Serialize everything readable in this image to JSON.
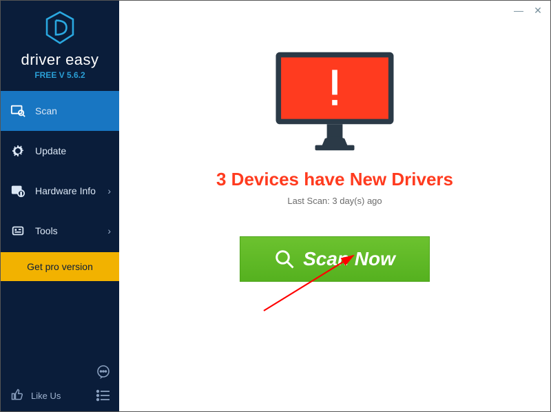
{
  "brand": {
    "name": "driver easy",
    "version": "FREE V 5.6.2"
  },
  "nav": {
    "scan": "Scan",
    "update": "Update",
    "hardware": "Hardware Info",
    "tools": "Tools"
  },
  "pro_button": "Get pro version",
  "like_us": "Like Us",
  "main": {
    "headline": "3 Devices have New Drivers",
    "last_scan": "Last Scan: 3 day(s) ago",
    "scan_button": "Scan Now"
  }
}
